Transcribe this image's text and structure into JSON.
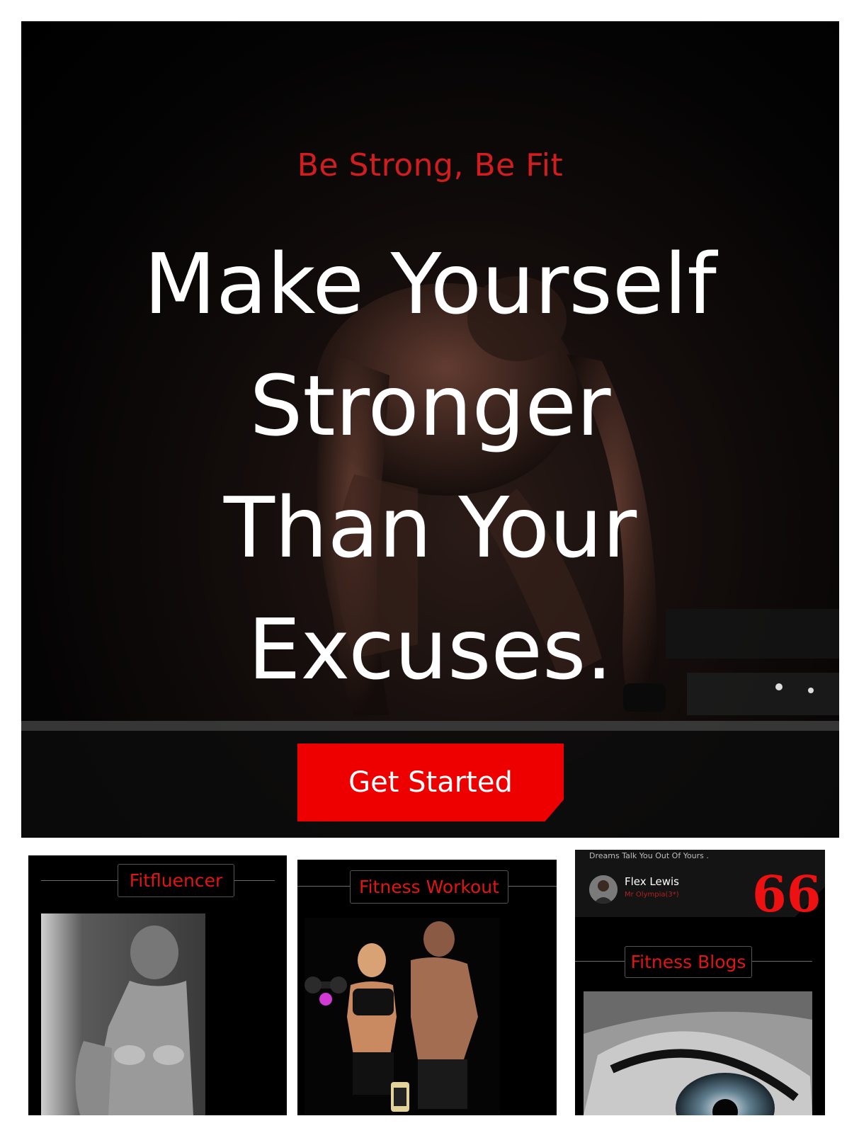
{
  "hero": {
    "tagline": "Be Strong, Be Fit",
    "heading_lines": [
      "Make Yourself",
      "Stronger",
      "Than Your",
      "Excuses."
    ],
    "cta_label": "Get Started"
  },
  "cards": {
    "fitfluencer": {
      "title": "Fitfluencer"
    },
    "workout": {
      "title": "Fitness Workout"
    },
    "blog": {
      "quote_text": "Dreams Talk You Out Of Yours .",
      "author_name": "Flex Lewis",
      "author_role": "Mr Olympia(3*)",
      "quote_icon": "66",
      "title": "Fitness Blogs"
    }
  },
  "colors": {
    "accent": "#ee0000",
    "text_accent": "#d11d1d",
    "background": "#000000"
  }
}
